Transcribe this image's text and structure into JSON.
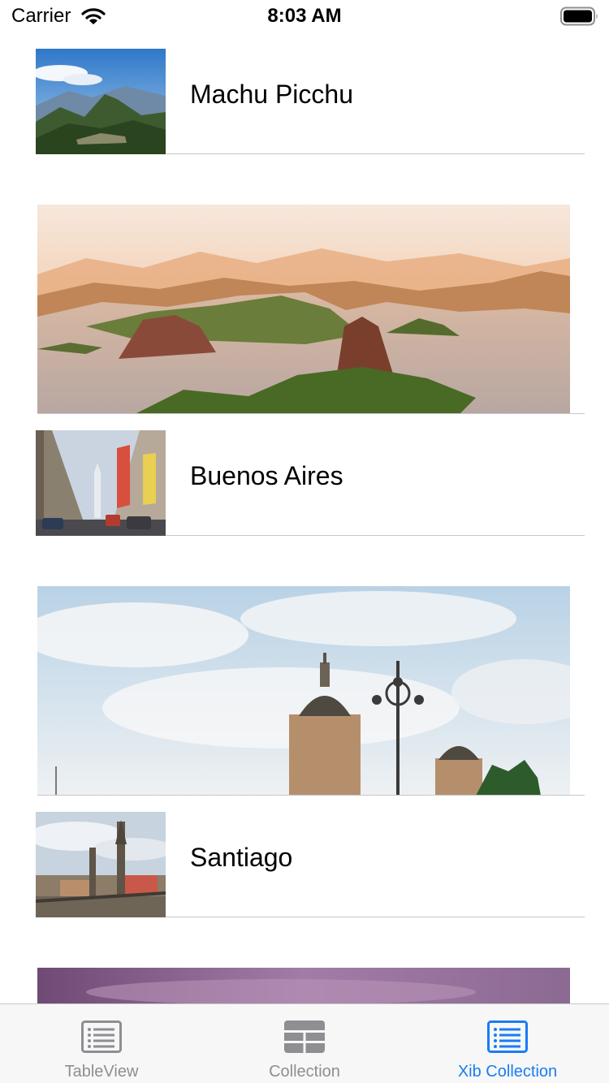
{
  "status_bar": {
    "carrier": "Carrier",
    "time": "8:03 AM",
    "icons": [
      "wifi-icon",
      "battery-icon"
    ]
  },
  "cities": [
    {
      "name": "Machu Picchu",
      "thumb": "machu-picchu-thumbnail"
    },
    {
      "name": "Buenos Aires",
      "thumb": "buenos-aires-thumbnail"
    },
    {
      "name": "Santiago",
      "thumb": "santiago-thumbnail"
    }
  ],
  "hero_images": [
    "rio-de-janeiro-panorama",
    "cathedral-towers-panorama",
    "purple-sky-panorama"
  ],
  "tab_bar": {
    "tabs": [
      {
        "label": "TableView",
        "icon": "list-icon",
        "active": false
      },
      {
        "label": "Collection",
        "icon": "grid-icon",
        "active": false
      },
      {
        "label": "Xib Collection",
        "icon": "list-icon",
        "active": true
      }
    ]
  },
  "colors": {
    "accent": "#1a7cf5",
    "inactive_tab": "#8e8e93",
    "divider": "#c8c7cc",
    "tab_bar_bg": "#f7f7f7"
  }
}
